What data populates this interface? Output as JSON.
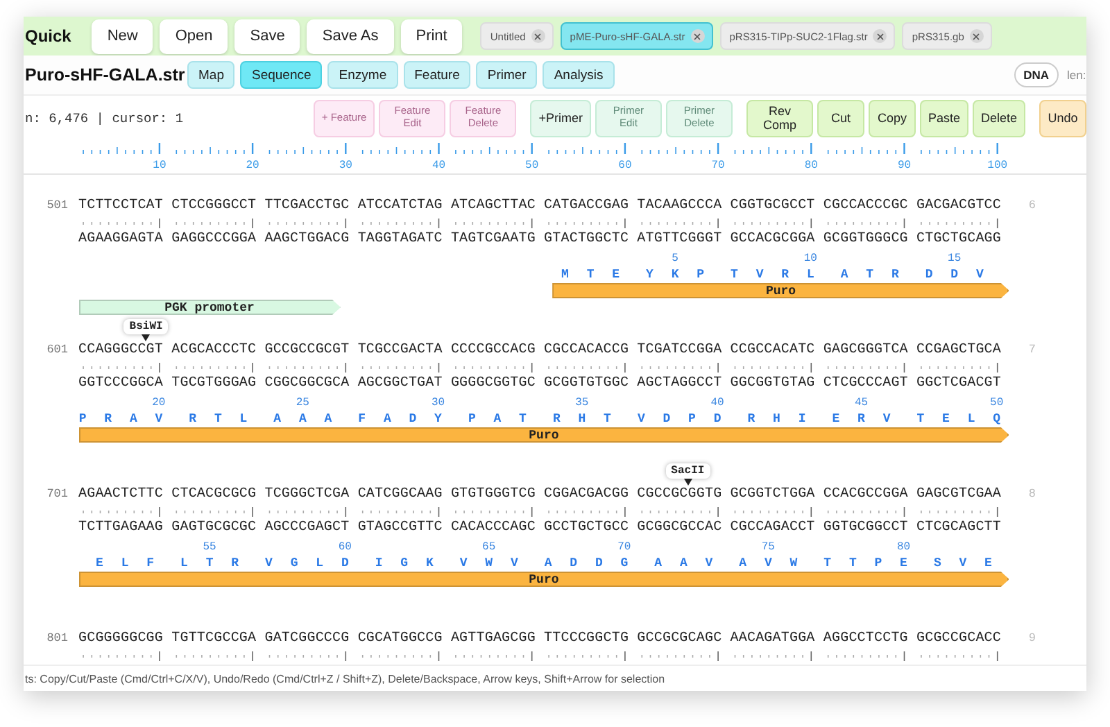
{
  "toolbar": {
    "title": "Quick",
    "buttons": [
      "New",
      "Open",
      "Save",
      "Save As",
      "Print"
    ],
    "file_tabs": [
      {
        "label": "Untitled",
        "selected": false
      },
      {
        "label": "pME-Puro-sHF-GALA.str",
        "selected": true
      },
      {
        "label": "pRS315-TIPp-SUC2-1Flag.str",
        "selected": false
      },
      {
        "label": "pRS315.gb",
        "selected": false
      }
    ]
  },
  "document": {
    "filename": "Puro-sHF-GALA.str",
    "view_tabs": [
      {
        "label": "Map",
        "selected": false
      },
      {
        "label": "Sequence",
        "selected": true
      },
      {
        "label": "Enzyme",
        "selected": false
      },
      {
        "label": "Feature",
        "selected": false
      },
      {
        "label": "Primer",
        "selected": false
      },
      {
        "label": "Analysis",
        "selected": false
      }
    ],
    "molecule": "DNA",
    "length_label": "len:"
  },
  "info": "n: 6,476 | cursor: 1",
  "edit_buttons": [
    {
      "label": "+ Feature",
      "kind": "feature",
      "disabled": true
    },
    {
      "label": "Feature Edit",
      "kind": "feature",
      "disabled": true
    },
    {
      "label": "Feature Delete",
      "kind": "feature",
      "disabled": true
    },
    {
      "label": "+Primer",
      "kind": "primer",
      "disabled": false
    },
    {
      "label": "Primer Edit",
      "kind": "primer",
      "disabled": true
    },
    {
      "label": "Primer Delete",
      "kind": "primer",
      "disabled": true
    },
    {
      "label": "Rev Comp",
      "kind": "edit",
      "disabled": false
    },
    {
      "label": "Cut",
      "kind": "edit",
      "disabled": false
    },
    {
      "label": "Copy",
      "kind": "edit",
      "disabled": false
    },
    {
      "label": "Paste",
      "kind": "edit",
      "disabled": false
    },
    {
      "label": "Delete",
      "kind": "edit",
      "disabled": false
    },
    {
      "label": "Undo",
      "kind": "history",
      "disabled": false
    }
  ],
  "ruler": [
    "10",
    "20",
    "30",
    "40",
    "50",
    "60",
    "70",
    "80",
    "90",
    "100"
  ],
  "blocks": [
    {
      "start": "501",
      "end": "6",
      "top": [
        {
          "bases": "TCTTCCTCAT CTCCGGGCCT TTCGACCT",
          "marks": [
            {
              "kind": "feature",
              "name": "PGK promoter",
              "color": "#d8f8e2",
              "continues": false
            }
          ]
        },
        {
          "bases": "GC ATCCATCTAG ATCAGCTTAC C"
        },
        {
          "bases": "ATGACCGAG TACAAGCCCA CGGTGCGCCT CGCCACCCGC GACGACGTCC",
          "marks": [
            {
              "kind": "translation1",
              "residues": [
                {
                  "aa": "M"
                },
                {
                  "aa": "T"
                },
                {
                  "aa": "E"
                },
                {
                  "aa": "Y"
                },
                {
                  "aa": "K",
                  "number": "5"
                },
                {
                  "aa": "P"
                },
                {
                  "aa": "T"
                },
                {
                  "aa": "V"
                },
                {
                  "aa": "R"
                },
                {
                  "aa": "L",
                  "number": "10"
                },
                {
                  "aa": "A"
                },
                {
                  "aa": "T"
                },
                {
                  "aa": "R"
                },
                {
                  "aa": "D"
                },
                {
                  "aa": "D",
                  "number": "15"
                },
                {
                  "aa": "V"
                }
              ]
            },
            {
              "kind": "feature",
              "name": "Puro",
              "color": "#fbb440"
            }
          ]
        }
      ],
      "bottom": "AGAAGGAGTA GAGGCCCGGA AAGCTGGACG TAGGTAGATC TAGTCGAATG GTACTGGCTC ATGTTCGGGT GCCACGCGGA GCGGTGGGCG CTGCTGCAGG"
    },
    {
      "start": "601",
      "end": "7",
      "top": [
        {
          "bases": "CCAGGGCC",
          "marks": [
            {
              "kind": "translation2",
              "residues": [
                {
                  "aa": "P"
                },
                {
                  "aa": "R"
                },
                {
                  "aa": "A"
                },
                {
                  "aa": "V",
                  "number": "20"
                },
                {
                  "aa": "R"
                },
                {
                  "aa": "T"
                },
                {
                  "aa": "L"
                },
                {
                  "aa": "A"
                },
                {
                  "aa": "A",
                  "number": "25"
                },
                {
                  "aa": "A"
                },
                {
                  "aa": "F"
                },
                {
                  "aa": "A"
                },
                {
                  "aa": "D"
                },
                {
                  "aa": "Y",
                  "number": "30"
                },
                {
                  "aa": "P"
                },
                {
                  "aa": "A"
                },
                {
                  "aa": "T"
                },
                {
                  "aa": "R"
                },
                {
                  "aa": "H",
                  "number": "35"
                },
                {
                  "aa": "T"
                },
                {
                  "aa": "V"
                },
                {
                  "aa": "D"
                },
                {
                  "aa": "P"
                },
                {
                  "aa": "D",
                  "number": "40"
                },
                {
                  "aa": "R"
                },
                {
                  "aa": "H"
                },
                {
                  "aa": "I"
                },
                {
                  "aa": "E"
                },
                {
                  "aa": "R",
                  "number": "45"
                },
                {
                  "aa": "V"
                },
                {
                  "aa": "T"
                },
                {
                  "aa": "E"
                },
                {
                  "aa": "L"
                },
                {
                  "aa": "Q",
                  "number": "50"
                }
              ]
            },
            {
              "kind": "feature",
              "name": "Puro",
              "color": "#fbb440",
              "continues": true
            }
          ]
        },
        {
          "bases": "GT ACGCACCCTC GCCGCCGCGT TCGCCGACTA CCCCGCCACG CGCCACACCG TCGATCCGGA CCGCCACATC GAGCGGGTCA CCGAGCTGCA",
          "marks": [
            {
              "kind": "enzyme",
              "name": "BsiWI"
            }
          ]
        }
      ],
      "bottom": "GGTCCCGGCA TGCGTGGGAG CGGCGGCGCA AGCGGCTGAT GGGGCGGTGC GCGGTGTGGC AGCTAGGCCT GGCGGTGTAG CTCGCCCAGT GGCTCGACGT"
    },
    {
      "start": "701",
      "end": "8",
      "top": [
        {
          "bases": "AGAACTCTTC CTCACGCGCG TCGGGCTCGA CATCGGCAAG GTGTGGGTCG CGGACGACGG CGCCGC",
          "marks": [
            {
              "kind": "translation3",
              "residues": [
                {
                  "aa": "E"
                },
                {
                  "aa": "L"
                },
                {
                  "aa": "F"
                },
                {
                  "aa": "L"
                },
                {
                  "aa": "T",
                  "number": "55"
                },
                {
                  "aa": "R"
                },
                {
                  "aa": "V"
                },
                {
                  "aa": "G"
                },
                {
                  "aa": "L"
                },
                {
                  "aa": "D",
                  "number": "60"
                },
                {
                  "aa": "I"
                },
                {
                  "aa": "G"
                },
                {
                  "aa": "K"
                },
                {
                  "aa": "V"
                },
                {
                  "aa": "W",
                  "number": "65"
                },
                {
                  "aa": "V"
                },
                {
                  "aa": "A"
                },
                {
                  "aa": "D"
                },
                {
                  "aa": "D"
                },
                {
                  "aa": "G",
                  "number": "70"
                },
                {
                  "aa": "A"
                },
                {
                  "aa": "A"
                },
                {
                  "aa": "V"
                },
                {
                  "aa": "A"
                },
                {
                  "aa": "V",
                  "number": "75"
                },
                {
                  "aa": "W"
                },
                {
                  "aa": "T"
                },
                {
                  "aa": "T"
                },
                {
                  "aa": "P"
                },
                {
                  "aa": "E",
                  "number": "80"
                },
                {
                  "aa": "S"
                },
                {
                  "aa": "V"
                },
                {
                  "aa": "E"
                }
              ]
            },
            {
              "kind": "feature",
              "name": "Puro",
              "color": "#fbb440",
              "continues": true
            }
          ]
        },
        {
          "bases": "GGTG GCGGTCTGGA CCACGCCGGA GAGCGTCGAA",
          "marks": [
            {
              "kind": "enzyme",
              "name": "SacII"
            }
          ]
        }
      ],
      "bottom": "TCTTGAGAAG GAGTGCGCGC AGCCCGAGCT GTAGCCGTTC CACACCCAGC GCCTGCTGCC GCGGCGCCAC CGCCAGACCT GGTGCGGCCT CTCGCAGCTT"
    },
    {
      "start": "801",
      "end": "9",
      "top": [
        {
          "bases": "GCGGGGGCGG TGTTCGCCGA GATCGGCCCG CGCATGGCCG AGTTGAGCGG TTCCCGGCTG GCCGCGCAGC AACAGATGGA AGGCCTCCTG GCGCCGCACC"
        }
      ]
    }
  ],
  "status": "ts: Copy/Cut/Paste (Cmd/Ctrl+C/X/V), Undo/Redo (Cmd/Ctrl+Z / Shift+Z), Delete/Backspace, Arrow keys, Shift+Arrow for selection"
}
